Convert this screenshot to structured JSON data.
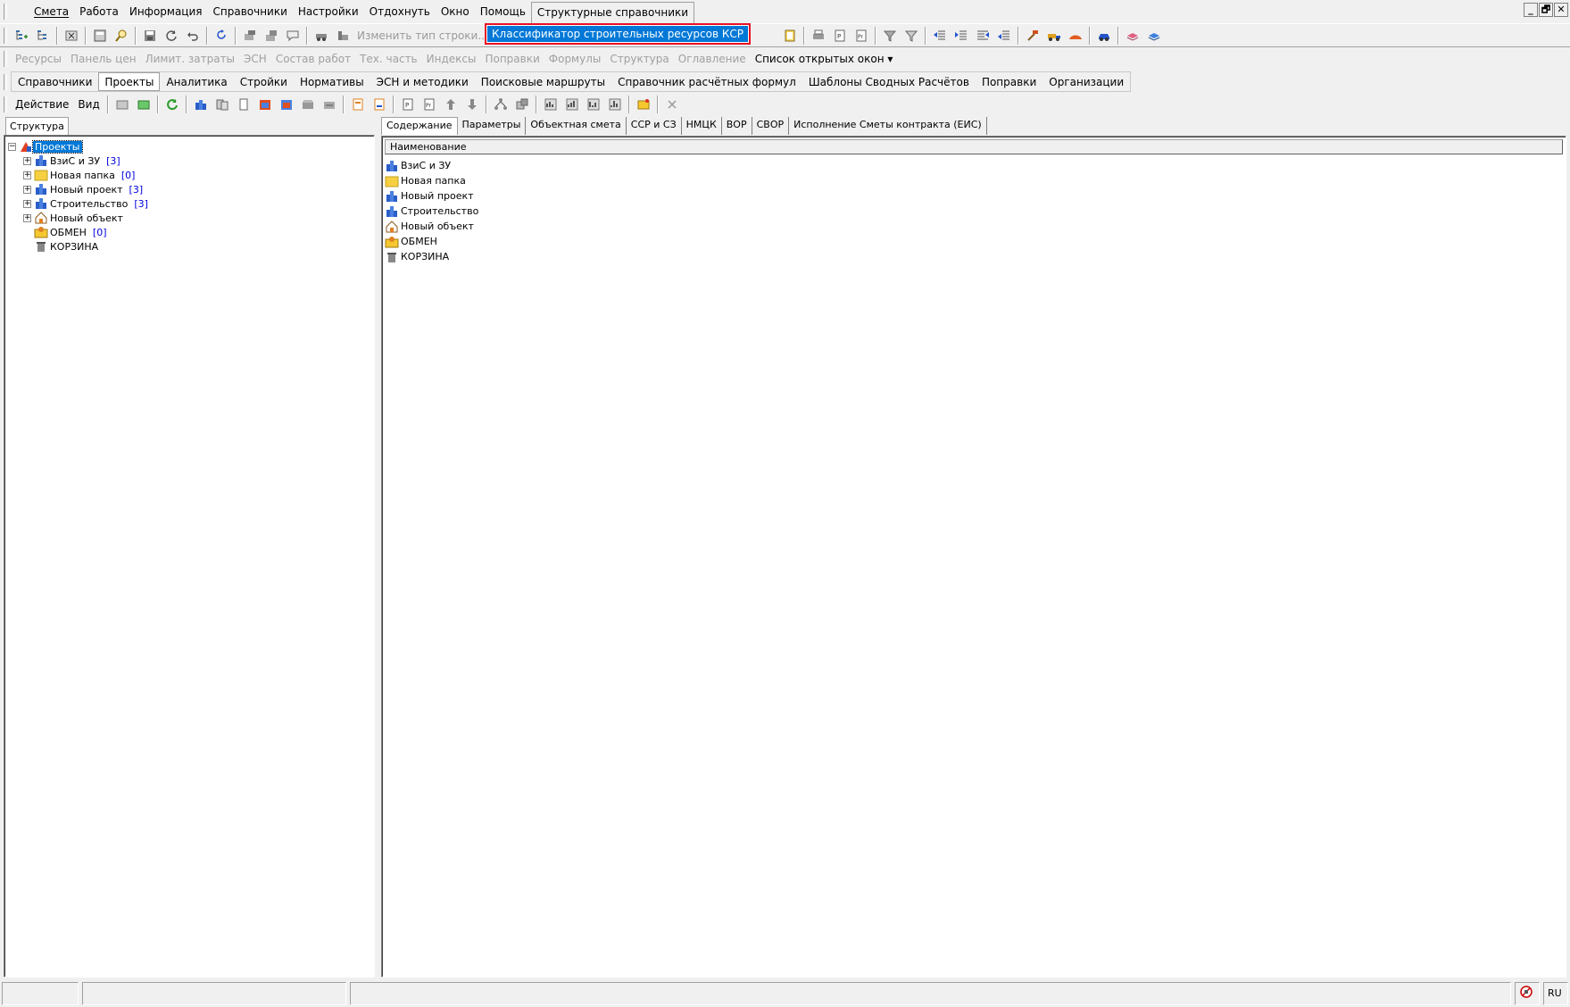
{
  "menubar": {
    "items": [
      "Смета",
      "Работа",
      "Информация",
      "Справочники",
      "Настройки",
      "Отдохнуть",
      "Окно",
      "Помощь",
      "Структурные справочники"
    ],
    "window_controls": [
      "_",
      "🗗",
      "✕"
    ]
  },
  "dropdown": {
    "item": "Классификатор строительных ресурсов КСР"
  },
  "toolbar1": {
    "change_row_type": "Изменить тип строки..."
  },
  "toolbar2": {
    "links": [
      "Ресурсы",
      "Панель цен",
      "Лимит. затраты",
      "ЭСН",
      "Состав работ",
      "Тех. часть",
      "Индексы",
      "Поправки",
      "Формулы",
      "Структура",
      "Оглавление"
    ],
    "open_windows": "Список открытых окон"
  },
  "tabs": {
    "items": [
      "Справочники",
      "Проекты",
      "Аналитика",
      "Стройки",
      "Нормативы",
      "ЭСН и методики",
      "Поисковые маршруты",
      "Справочник расчётных формул",
      "Шаблоны Сводных Расчётов",
      "Поправки",
      "Организации"
    ]
  },
  "toolbar3": {
    "action": "Действие",
    "view": "Вид"
  },
  "left_panel": {
    "tab": "Структура",
    "root": "Проекты",
    "nodes": [
      {
        "label": "ВзиС и ЗУ",
        "count": "[3]",
        "icon": "building-icon"
      },
      {
        "label": "Новая папка",
        "count": "[0]",
        "icon": "folder-icon"
      },
      {
        "label": "Новый проект",
        "count": "[3]",
        "icon": "building-icon"
      },
      {
        "label": "Строительство",
        "count": "[3]",
        "icon": "building-icon"
      },
      {
        "label": "Новый объект",
        "count": "",
        "icon": "house-icon"
      },
      {
        "label": "ОБМЕН",
        "count": "[0]",
        "icon": "exchange-icon"
      },
      {
        "label": "КОРЗИНА",
        "count": "",
        "icon": "trash-icon"
      }
    ]
  },
  "right_panel": {
    "tabs": [
      "Содержание",
      "Параметры",
      "Объектная смета",
      "ССР и СЗ",
      "НМЦК",
      "ВОР",
      "СВОР",
      "Исполнение Сметы контракта (ЕИС)"
    ],
    "column_header": "Наименование",
    "rows": [
      "ВзиС и ЗУ",
      "Новая папка",
      "Новый проект",
      "Строительство",
      "Новый объект",
      "ОБМЕН",
      "КОРЗИНА"
    ]
  },
  "statusbar": {
    "lang": "RU"
  },
  "colors": {
    "selection": "#0078d7",
    "highlight_border": "#e81123",
    "count_text": "#0000e0"
  }
}
